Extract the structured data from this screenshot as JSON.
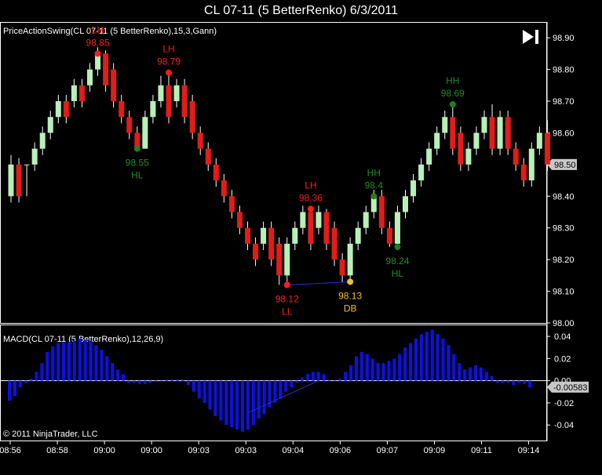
{
  "window_title": "CL 07-11 (5 BetterRenko)  6/3/2011",
  "copyright": "© 2011 NinjaTrader, LLC",
  "colors": {
    "background": "#000000",
    "up_candle": "#b8f0b8",
    "down_candle": "#e31b1b",
    "wick": "#ffffff",
    "macd_bar": "#0e10e6",
    "grid": "#ffffff",
    "low_marker_red": "#ff1b1b",
    "high_marker_green": "#1f7f1f",
    "db_marker": "#f2c12e",
    "label_red": "#ff1b1b",
    "label_green": "#1f8f1f",
    "label_yellow": "#f2c12e",
    "price_tag_bg": "#c8c8c8"
  },
  "icons": {
    "play_pause": "next-frame-icon"
  },
  "chart_data": [
    {
      "type": "candlestick",
      "title": "PriceActionSwing(CL 07-11 (5 BetterRenko),15,3,Gann)",
      "ylim": [
        98.0,
        98.95
      ],
      "yticks": [
        "98.00",
        "98.10",
        "98.20",
        "98.30",
        "98.40",
        "98.50",
        "98.60",
        "98.70",
        "98.80",
        "98.90"
      ],
      "last_price_tag": "98.50",
      "candles": [
        {
          "o": 98.4,
          "c": 98.5,
          "h": 98.53,
          "l": 98.38
        },
        {
          "o": 98.5,
          "c": 98.4,
          "h": 98.52,
          "l": 98.38
        },
        {
          "o": 98.5,
          "c": 98.5,
          "h": 98.5,
          "l": 98.4
        },
        {
          "o": 98.5,
          "c": 98.55,
          "h": 98.57,
          "l": 98.48
        },
        {
          "o": 98.55,
          "c": 98.6,
          "h": 98.62,
          "l": 98.53
        },
        {
          "o": 98.6,
          "c": 98.65,
          "h": 98.67,
          "l": 98.58
        },
        {
          "o": 98.65,
          "c": 98.7,
          "h": 98.72,
          "l": 98.63
        },
        {
          "o": 98.7,
          "c": 98.65,
          "h": 98.72,
          "l": 98.63
        },
        {
          "o": 98.7,
          "c": 98.75,
          "h": 98.77,
          "l": 98.68
        },
        {
          "o": 98.75,
          "c": 98.7,
          "h": 98.77,
          "l": 98.68
        },
        {
          "o": 98.75,
          "c": 98.8,
          "h": 98.82,
          "l": 98.73
        },
        {
          "o": 98.8,
          "c": 98.85,
          "h": 98.87,
          "l": 98.78
        },
        {
          "o": 98.85,
          "c": 98.75,
          "h": 98.86,
          "l": 98.73
        },
        {
          "o": 98.8,
          "c": 98.7,
          "h": 98.82,
          "l": 98.68
        },
        {
          "o": 98.7,
          "c": 98.65,
          "h": 98.72,
          "l": 98.63
        },
        {
          "o": 98.65,
          "c": 98.6,
          "h": 98.67,
          "l": 98.58
        },
        {
          "o": 98.6,
          "c": 98.55,
          "h": 98.62,
          "l": 98.55
        },
        {
          "o": 98.55,
          "c": 98.65,
          "h": 98.67,
          "l": 98.55
        },
        {
          "o": 98.65,
          "c": 98.7,
          "h": 98.72,
          "l": 98.63
        },
        {
          "o": 98.7,
          "c": 98.75,
          "h": 98.78,
          "l": 98.68
        },
        {
          "o": 98.75,
          "c": 98.65,
          "h": 98.79,
          "l": 98.63
        },
        {
          "o": 98.7,
          "c": 98.75,
          "h": 98.77,
          "l": 98.68
        },
        {
          "o": 98.75,
          "c": 98.65,
          "h": 98.77,
          "l": 98.63
        },
        {
          "o": 98.7,
          "c": 98.6,
          "h": 98.72,
          "l": 98.58
        },
        {
          "o": 98.6,
          "c": 98.55,
          "h": 98.62,
          "l": 98.53
        },
        {
          "o": 98.55,
          "c": 98.5,
          "h": 98.57,
          "l": 98.48
        },
        {
          "o": 98.5,
          "c": 98.45,
          "h": 98.52,
          "l": 98.43
        },
        {
          "o": 98.45,
          "c": 98.4,
          "h": 98.47,
          "l": 98.38
        },
        {
          "o": 98.4,
          "c": 98.35,
          "h": 98.42,
          "l": 98.33
        },
        {
          "o": 98.35,
          "c": 98.3,
          "h": 98.37,
          "l": 98.28
        },
        {
          "o": 98.3,
          "c": 98.25,
          "h": 98.32,
          "l": 98.23
        },
        {
          "o": 98.25,
          "c": 98.2,
          "h": 98.27,
          "l": 98.18
        },
        {
          "o": 98.25,
          "c": 98.3,
          "h": 98.32,
          "l": 98.23
        },
        {
          "o": 98.3,
          "c": 98.2,
          "h": 98.32,
          "l": 98.18
        },
        {
          "o": 98.25,
          "c": 98.15,
          "h": 98.27,
          "l": 98.12
        },
        {
          "o": 98.15,
          "c": 98.25,
          "h": 98.27,
          "l": 98.13
        },
        {
          "o": 98.25,
          "c": 98.3,
          "h": 98.32,
          "l": 98.23
        },
        {
          "o": 98.3,
          "c": 98.35,
          "h": 98.37,
          "l": 98.28
        },
        {
          "o": 98.35,
          "c": 98.25,
          "h": 98.37,
          "l": 98.23
        },
        {
          "o": 98.3,
          "c": 98.35,
          "h": 98.37,
          "l": 98.28
        },
        {
          "o": 98.35,
          "c": 98.25,
          "h": 98.36,
          "l": 98.23
        },
        {
          "o": 98.3,
          "c": 98.2,
          "h": 98.32,
          "l": 98.18
        },
        {
          "o": 98.2,
          "c": 98.15,
          "h": 98.22,
          "l": 98.13
        },
        {
          "o": 98.15,
          "c": 98.25,
          "h": 98.27,
          "l": 98.13
        },
        {
          "o": 98.25,
          "c": 98.3,
          "h": 98.32,
          "l": 98.23
        },
        {
          "o": 98.3,
          "c": 98.35,
          "h": 98.37,
          "l": 98.28
        },
        {
          "o": 98.35,
          "c": 98.4,
          "h": 98.42,
          "l": 98.33
        },
        {
          "o": 98.4,
          "c": 98.3,
          "h": 98.42,
          "l": 98.28
        },
        {
          "o": 98.3,
          "c": 98.25,
          "h": 98.32,
          "l": 98.24
        },
        {
          "o": 98.25,
          "c": 98.35,
          "h": 98.37,
          "l": 98.23
        },
        {
          "o": 98.35,
          "c": 98.4,
          "h": 98.42,
          "l": 98.33
        },
        {
          "o": 98.4,
          "c": 98.45,
          "h": 98.47,
          "l": 98.38
        },
        {
          "o": 98.45,
          "c": 98.5,
          "h": 98.52,
          "l": 98.43
        },
        {
          "o": 98.5,
          "c": 98.55,
          "h": 98.57,
          "l": 98.48
        },
        {
          "o": 98.55,
          "c": 98.6,
          "h": 98.62,
          "l": 98.53
        },
        {
          "o": 98.6,
          "c": 98.65,
          "h": 98.67,
          "l": 98.58
        },
        {
          "o": 98.65,
          "c": 98.55,
          "h": 98.69,
          "l": 98.53
        },
        {
          "o": 98.6,
          "c": 98.5,
          "h": 98.62,
          "l": 98.48
        },
        {
          "o": 98.5,
          "c": 98.55,
          "h": 98.57,
          "l": 98.48
        },
        {
          "o": 98.55,
          "c": 98.6,
          "h": 98.62,
          "l": 98.53
        },
        {
          "o": 98.6,
          "c": 98.65,
          "h": 98.67,
          "l": 98.58
        },
        {
          "o": 98.65,
          "c": 98.55,
          "h": 98.69,
          "l": 98.53
        },
        {
          "o": 98.55,
          "c": 98.65,
          "h": 98.67,
          "l": 98.53
        },
        {
          "o": 98.65,
          "c": 98.55,
          "h": 98.67,
          "l": 98.53
        },
        {
          "o": 98.55,
          "c": 98.5,
          "h": 98.57,
          "l": 98.48
        },
        {
          "o": 98.5,
          "c": 98.45,
          "h": 98.52,
          "l": 98.43
        },
        {
          "o": 98.45,
          "c": 98.55,
          "h": 98.57,
          "l": 98.43
        },
        {
          "o": 98.55,
          "c": 98.6,
          "h": 98.62,
          "l": 98.53
        },
        {
          "o": 98.6,
          "c": 98.5,
          "h": 98.64,
          "l": 98.48
        }
      ],
      "swing_annotations": [
        {
          "index": 11,
          "price": 98.85,
          "label": "LH",
          "value": "98.85",
          "side": "above",
          "color": "red"
        },
        {
          "index": 16,
          "price": 98.55,
          "label": "HL",
          "value": "98.55",
          "side": "below",
          "color": "green"
        },
        {
          "index": 20,
          "price": 98.79,
          "label": "LH",
          "value": "98.79",
          "side": "above",
          "color": "red"
        },
        {
          "index": 35,
          "price": 98.12,
          "label": "LL",
          "value": "98.12",
          "side": "below",
          "color": "red"
        },
        {
          "index": 38,
          "price": 98.36,
          "label": "LH",
          "value": "98.36",
          "side": "above",
          "color": "red"
        },
        {
          "index": 43,
          "price": 98.13,
          "label": "DB",
          "value": "98.13",
          "side": "below",
          "color": "yellow"
        },
        {
          "index": 46,
          "price": 98.4,
          "label": "HH",
          "value": "98.4",
          "side": "above",
          "color": "green"
        },
        {
          "index": 49,
          "price": 98.24,
          "label": "HL",
          "value": "98.24",
          "side": "below",
          "color": "green"
        },
        {
          "index": 56,
          "price": 98.69,
          "label": "HH",
          "value": "98.69",
          "side": "above",
          "color": "green"
        }
      ],
      "divergence_line": {
        "from": {
          "index": 35,
          "price": 98.12
        },
        "to": {
          "index": 43,
          "price": 98.13
        }
      }
    },
    {
      "type": "bar",
      "title": "MACD(CL 07-11 (5 BetterRenko),12,26,9)",
      "ylim": [
        -0.054,
        0.05
      ],
      "yticks": [
        "0.04",
        "0.02",
        "0.00",
        "-0.02",
        "-0.04"
      ],
      "last_value_tag": "-0.00583",
      "values": [
        -0.018,
        -0.014,
        -0.006,
        -0.002,
        0.002,
        0.008,
        0.016,
        0.026,
        0.031,
        0.034,
        0.035,
        0.035,
        0.036,
        0.038,
        0.037,
        0.036,
        0.032,
        0.028,
        0.022,
        0.016,
        0.01,
        0.006,
        -0.002,
        -0.002,
        -0.003,
        -0.003,
        -0.002,
        -0.001,
        -0.001,
        0.001,
        0.001,
        0.001,
        0.001,
        -0.004,
        -0.01,
        -0.016,
        -0.02,
        -0.026,
        -0.032,
        -0.036,
        -0.04,
        -0.042,
        -0.044,
        -0.046,
        -0.044,
        -0.04,
        -0.034,
        -0.03,
        -0.024,
        -0.02,
        -0.016,
        -0.01,
        -0.006,
        -0.002,
        0.003,
        0.006,
        0.008,
        0.008,
        0.006,
        0.001,
        -0.001,
        0.002,
        0.008,
        0.014,
        0.022,
        0.026,
        0.024,
        0.02,
        0.016,
        0.016,
        0.018,
        0.02,
        0.024,
        0.03,
        0.034,
        0.038,
        0.042,
        0.044,
        0.046,
        0.042,
        0.038,
        0.032,
        0.024,
        0.016,
        0.01,
        0.012,
        0.014,
        0.012,
        0.008,
        0.004,
        -0.002,
        -0.002,
        -0.002,
        -0.004,
        -0.002,
        -0.003,
        -0.006
      ],
      "divergence_line": {
        "from": {
          "index": 44,
          "value": -0.029
        },
        "to": {
          "index": 57,
          "value": 0.0
        }
      }
    }
  ],
  "time_axis": {
    "labels": [
      "08:56",
      "08:58",
      "09:00",
      "09:00",
      "09:03",
      "09:03",
      "09:04",
      "09:06",
      "09:07",
      "09:09",
      "09:11",
      "09:14"
    ]
  }
}
